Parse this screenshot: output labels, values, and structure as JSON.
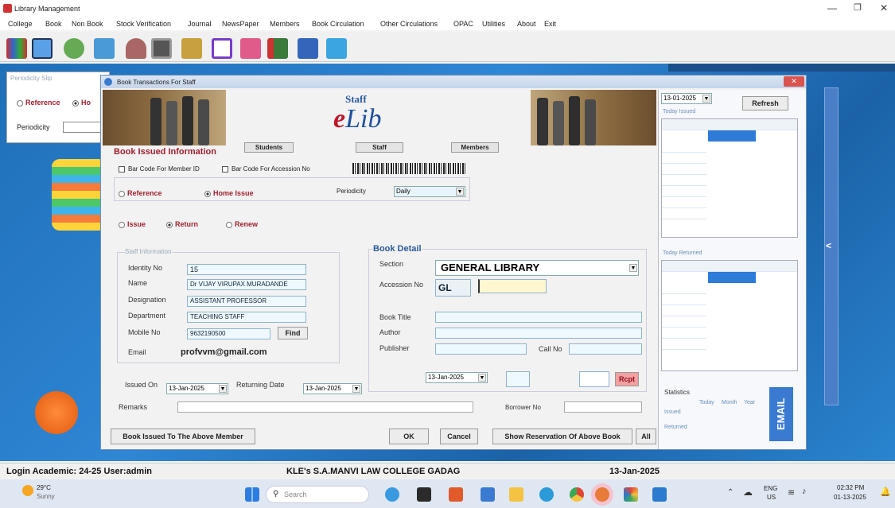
{
  "window": {
    "title": "Library Management"
  },
  "menu": [
    "College",
    "Book",
    "Non Book",
    "Stock Verification",
    "Journal",
    "NewsPaper",
    "Members",
    "Book Circulation",
    "Other Circulations",
    "OPAC",
    "Utilities",
    "About",
    "Exit"
  ],
  "toolbar_icons": [
    "books-icon",
    "window-icon",
    "person-icon",
    "tools-icon",
    "user-icon",
    "id-card-icon",
    "book-icon",
    "file-icon",
    "heart-icon",
    "book-red-icon",
    "list-icon",
    "pen-icon"
  ],
  "background_panel": {
    "title": "Periodicity Slip",
    "reference": "Reference",
    "home": "Ho",
    "periodicity": "Periodicity"
  },
  "dialog": {
    "title": "Book Transactions For Staff",
    "banner_top": "Staff",
    "banner_logo": "Lib",
    "banner_logo_prefix": "e",
    "section_title": "Book Issued Information",
    "tabs": {
      "students": "Students",
      "staff": "Staff",
      "members": "Members"
    },
    "barcode_member": "Bar Code For Member ID",
    "barcode_accession": "Bar Code For Accession No",
    "reference": "Reference",
    "home_issue": "Home Issue",
    "periodicity_label": "Periodicity",
    "periodicity_value": "Daily",
    "issue": "Issue",
    "return": "Return",
    "renew": "Renew",
    "staff_info": {
      "title": "Staff Information",
      "identity_label": "Identity No",
      "identity": "15",
      "name_label": "Name",
      "name": "Dr VIJAY VIRUPAX MURADANDE",
      "designation_label": "Designation",
      "designation": "ASSISTANT PROFESSOR",
      "department_label": "Department",
      "department": "TEACHING STAFF",
      "mobile_label": "Mobile No",
      "mobile": "9632190500",
      "find": "Find",
      "email_label": "Email",
      "email": "profvvm@gmail.com"
    },
    "book_detail": {
      "title": "Book Detail",
      "section_label": "Section",
      "section": "GENERAL LIBRARY",
      "accession_label": "Accession No",
      "accession_prefix": "GL",
      "book_title_label": "Book Title",
      "author_label": "Author",
      "publisher_label": "Publisher",
      "callno_label": "Call No",
      "date": "13-Jan-2025",
      "rcpt": "Rcpt"
    },
    "issued_on_label": "Issued On",
    "issued_on": "13-Jan-2025",
    "returning_label": "Returning Date",
    "returning": "13-Jan-2025",
    "remarks_label": "Remarks",
    "borrower_label": "Borrower No",
    "btn_issued": "Book Issued To The Above Member",
    "btn_ok": "OK",
    "btn_cancel": "Cancel",
    "btn_reservation": "Show Reservation Of Above Book",
    "btn_all": "All",
    "right": {
      "date": "13-01-2025",
      "refresh": "Refresh",
      "today_issued": "Today Issued",
      "today_returned": "Today Returned",
      "statistics": "Statistics",
      "today": "Today",
      "month": "Month",
      "year": "Year",
      "issued": "Issued",
      "returned": "Returned",
      "email": "EMAIL"
    }
  },
  "status": {
    "login": "Login Academic: 24-25 User:admin",
    "college": "KLE's S.A.MANVI LAW COLLEGE GADAG",
    "date": "13-Jan-2025"
  },
  "taskbar": {
    "temp": "29°C",
    "weather": "Sunny",
    "search": "Search",
    "lang": "ENG",
    "region": "US",
    "time": "02:32 PM",
    "date": "01-13-2025"
  },
  "colors": {
    "desk": "#1f6fb8",
    "highlight": "#2f7bd8",
    "brand_red": "#a01f2f",
    "field_bg": "#eef9ff"
  }
}
